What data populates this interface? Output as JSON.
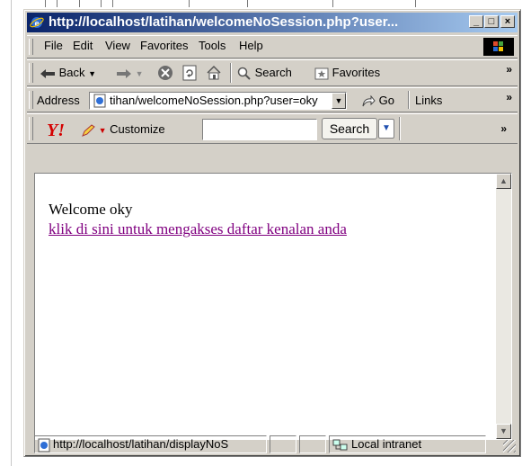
{
  "window": {
    "title": "http://localhost/latihan/welcomeNoSession.php?user...",
    "minimize_label": "_",
    "maximize_label": "□",
    "close_label": "×"
  },
  "menu": {
    "items": [
      {
        "label": "File"
      },
      {
        "label": "Edit"
      },
      {
        "label": "View"
      },
      {
        "label": "Favorites"
      },
      {
        "label": "Tools"
      },
      {
        "label": "Help"
      }
    ]
  },
  "toolbar": {
    "back_label": "Back",
    "search_label": "Search",
    "favorites_label": "Favorites",
    "more_label": "»"
  },
  "address": {
    "label": "Address",
    "value": "tihan/welcomeNoSession.php?user=oky",
    "go_label": "Go",
    "links_label": "Links",
    "more_label": "»"
  },
  "yahoo": {
    "customize_label": "Customize",
    "search_value": "",
    "search_button": "Search",
    "more_label": "»"
  },
  "page": {
    "welcome_text": "Welcome oky",
    "link_text": "klik di sini untuk mengakses daftar kenalan anda"
  },
  "status": {
    "url": "http://localhost/latihan/displayNoS",
    "zone": "Local intranet"
  },
  "colors": {
    "titlebar_start": "#0a246a",
    "titlebar_end": "#a6caf0",
    "chrome": "#d4d0c8",
    "visited_link": "#800080"
  },
  "icons": [
    "ie-icon",
    "back-arrow-icon",
    "forward-arrow-icon",
    "stop-icon",
    "refresh-icon",
    "home-icon",
    "search-icon",
    "favorites-icon",
    "go-icon",
    "yahoo-logo-icon",
    "pencil-icon",
    "page-icon",
    "intranet-icon",
    "windows-logo-icon"
  ]
}
